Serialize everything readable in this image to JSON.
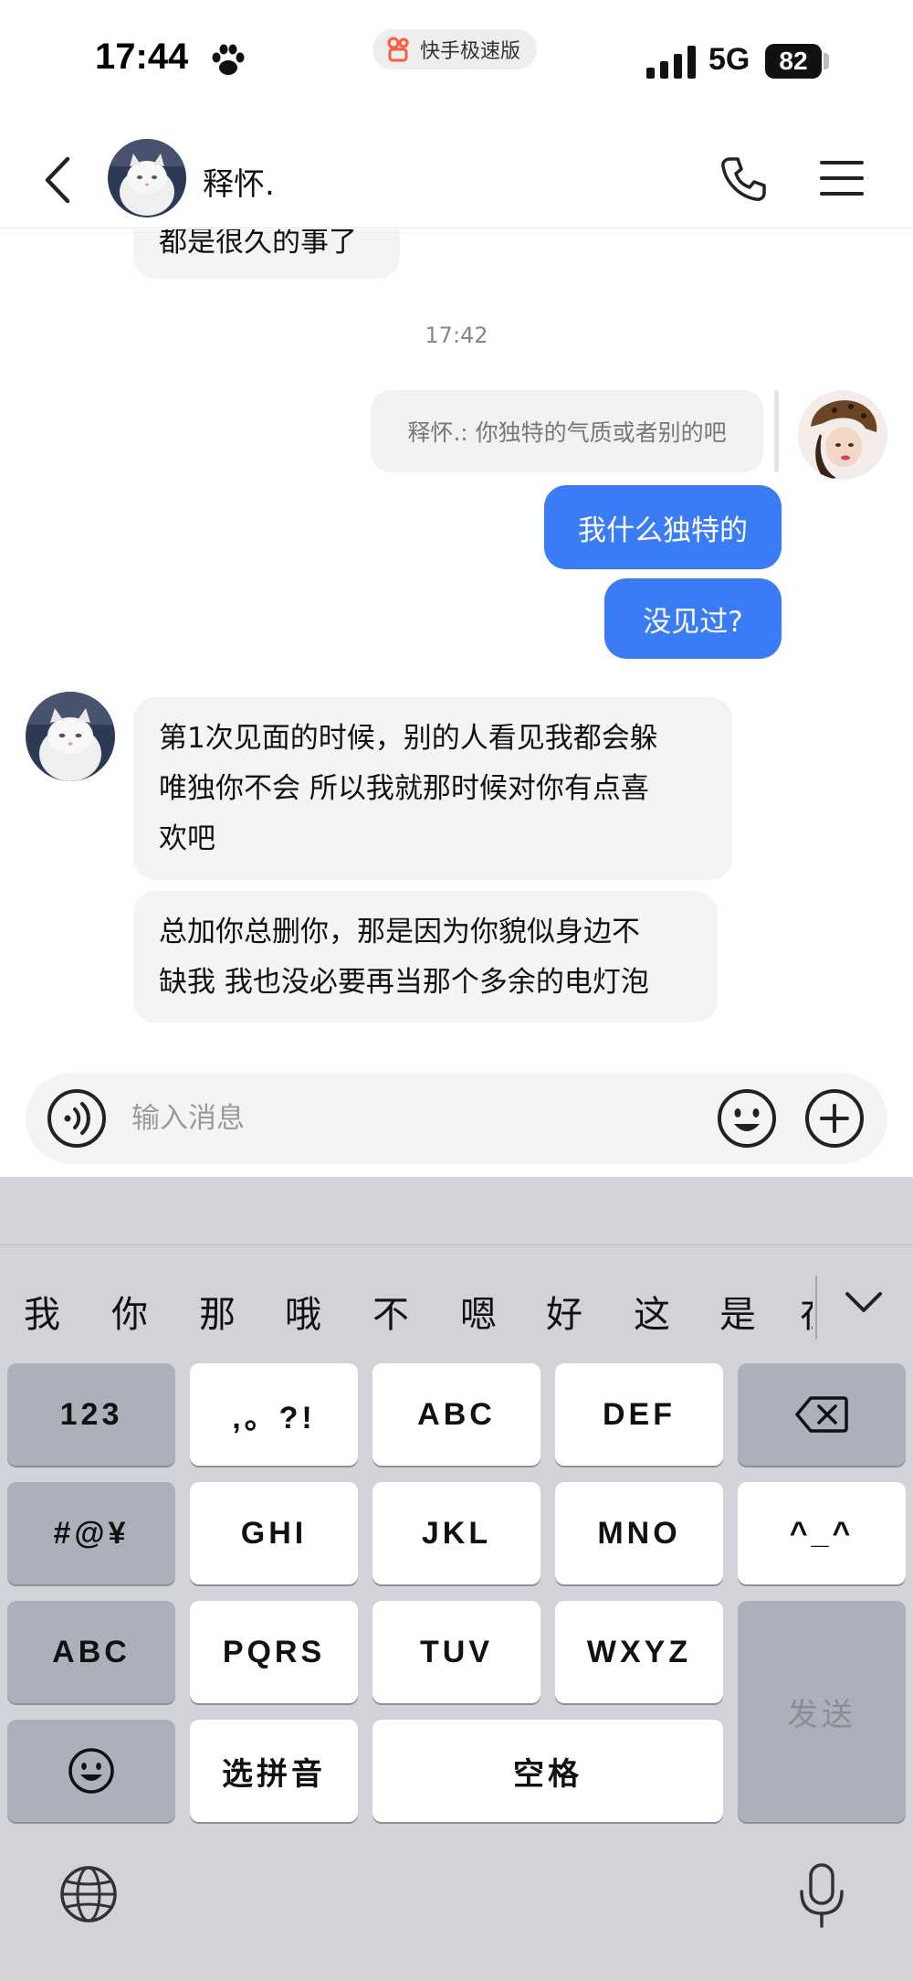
{
  "status": {
    "time": "17:44",
    "app_badge": "快手极速版",
    "network": "5G",
    "battery": "82"
  },
  "header": {
    "contact_name": "释怀."
  },
  "messages": {
    "partial_top": "都是很久的事了",
    "timestamp": "17:42",
    "quote": "释怀.: 你独特的气质或者别的吧",
    "out1": "我什么独特的",
    "out2": "没见过?",
    "in1_line1": "第1次见面的时候，别的人看见我都会躲",
    "in1_line2": "唯独你不会 所以我就那时候对你有点喜",
    "in1_line3": "欢吧",
    "in2_line1": "总加你总删你，那是因为你貌似身边不",
    "in2_line2": "缺我 我也没必要再当那个多余的电灯泡"
  },
  "input": {
    "placeholder": "输入消息"
  },
  "keyboard": {
    "candidates": [
      "我",
      "你",
      "那",
      "哦",
      "不",
      "嗯",
      "好",
      "这",
      "是",
      "在"
    ],
    "keys": {
      "num": "123",
      "punct": ",。?!",
      "abc_key": "ABC",
      "def": "DEF",
      "symbols": "#@¥",
      "ghi": "GHI",
      "jkl": "JKL",
      "mno": "MNO",
      "emoticon": "^_^",
      "abc_mode": "ABC",
      "pqrs": "PQRS",
      "tuv": "TUV",
      "wxyz": "WXYZ",
      "send": "发送",
      "pinyin": "选拼音",
      "space": "空格"
    }
  },
  "colors": {
    "accent_blue": "#3a7bf6",
    "incoming_bubble": "#f4f4f4",
    "keyboard_bg": "#d1d3d9"
  },
  "icons": [
    "paw-icon",
    "back-icon",
    "phone-icon",
    "menu-icon",
    "voice-icon",
    "emoji-icon",
    "plus-icon",
    "delete-icon",
    "emoji-key-icon",
    "globe-icon",
    "mic-icon",
    "chevron-down-icon"
  ]
}
